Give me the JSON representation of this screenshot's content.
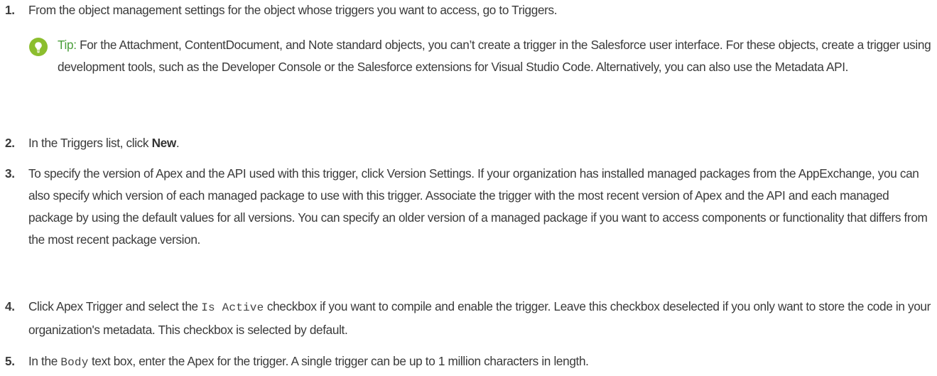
{
  "steps": [
    {
      "number": "1.",
      "text": "From the object management settings for the object whose triggers you want to access, go to Triggers."
    },
    {
      "number": "2.",
      "text_before": "In the Triggers list, click ",
      "bold": "New",
      "text_after": "."
    },
    {
      "number": "3.",
      "text": "To specify the version of Apex and the API used with this trigger, click Version Settings. If your organization has installed managed packages from the AppExchange, you can also specify which version of each managed package to use with this trigger. Associate the trigger with the most recent version of Apex and the API and each managed package by using the default values for all versions. You can specify an older version of a managed package if you want to access components or functionality that differs from the most recent package version."
    },
    {
      "number": "4.",
      "text_before": "Click Apex Trigger and select the ",
      "code": "Is Active",
      "text_after": " checkbox if you want to compile and enable the trigger. Leave this checkbox deselected if you only want to store the code in your organization's metadata. This checkbox is selected by default."
    },
    {
      "number": "5.",
      "text_before": "In the ",
      "code": "Body",
      "text_after": " text box, enter the Apex for the trigger. A single trigger can be up to 1 million characters in length."
    }
  ],
  "tip": {
    "label": "Tip:",
    "text": "For the Attachment, ContentDocument, and Note standard objects, you can’t create a trigger in the Salesforce user interface. For these objects, create a trigger using development tools, such as the Developer Console or the Salesforce extensions for Visual Studio Code. Alternatively, you can also use the Metadata API.",
    "icon": "lightbulb-icon",
    "icon_color": "#8cbe2e",
    "label_color": "#4a9e3a"
  }
}
